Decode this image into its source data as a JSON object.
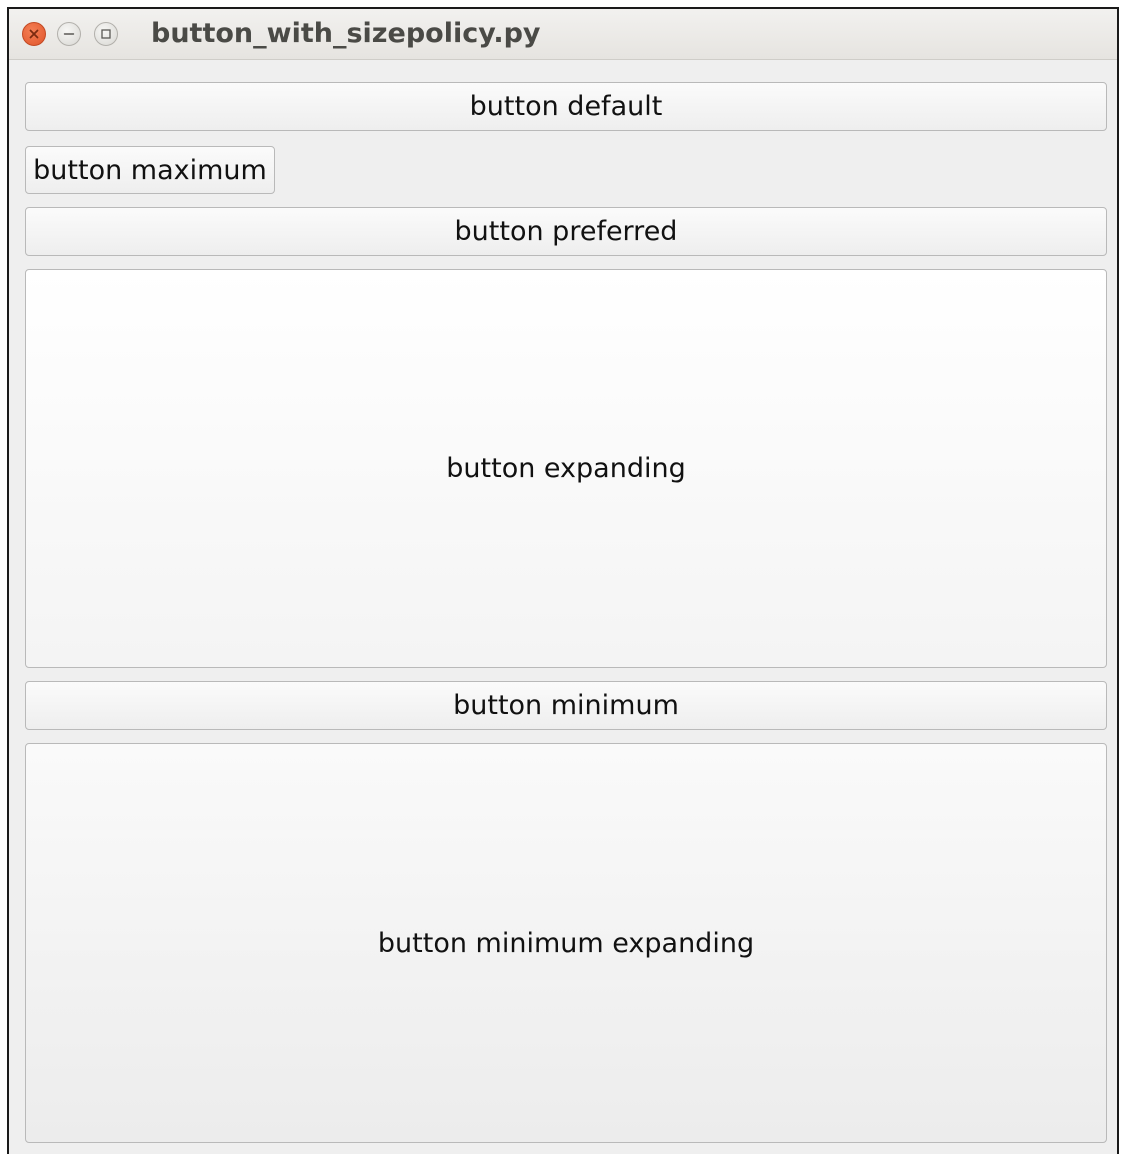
{
  "window": {
    "title": "button_with_sizepolicy.py"
  },
  "titlebar_icons": [
    "close-icon",
    "minimize-icon",
    "maximize-icon"
  ],
  "buttons": [
    {
      "label": "button default"
    },
    {
      "label": "button maximum"
    },
    {
      "label": "button preferred"
    },
    {
      "label": "button expanding"
    },
    {
      "label": "button minimum"
    },
    {
      "label": "button minimum expanding"
    }
  ],
  "colors": {
    "close_button": "#e0552b",
    "window_bg": "#efefef",
    "button_border": "#b9b9b9"
  }
}
